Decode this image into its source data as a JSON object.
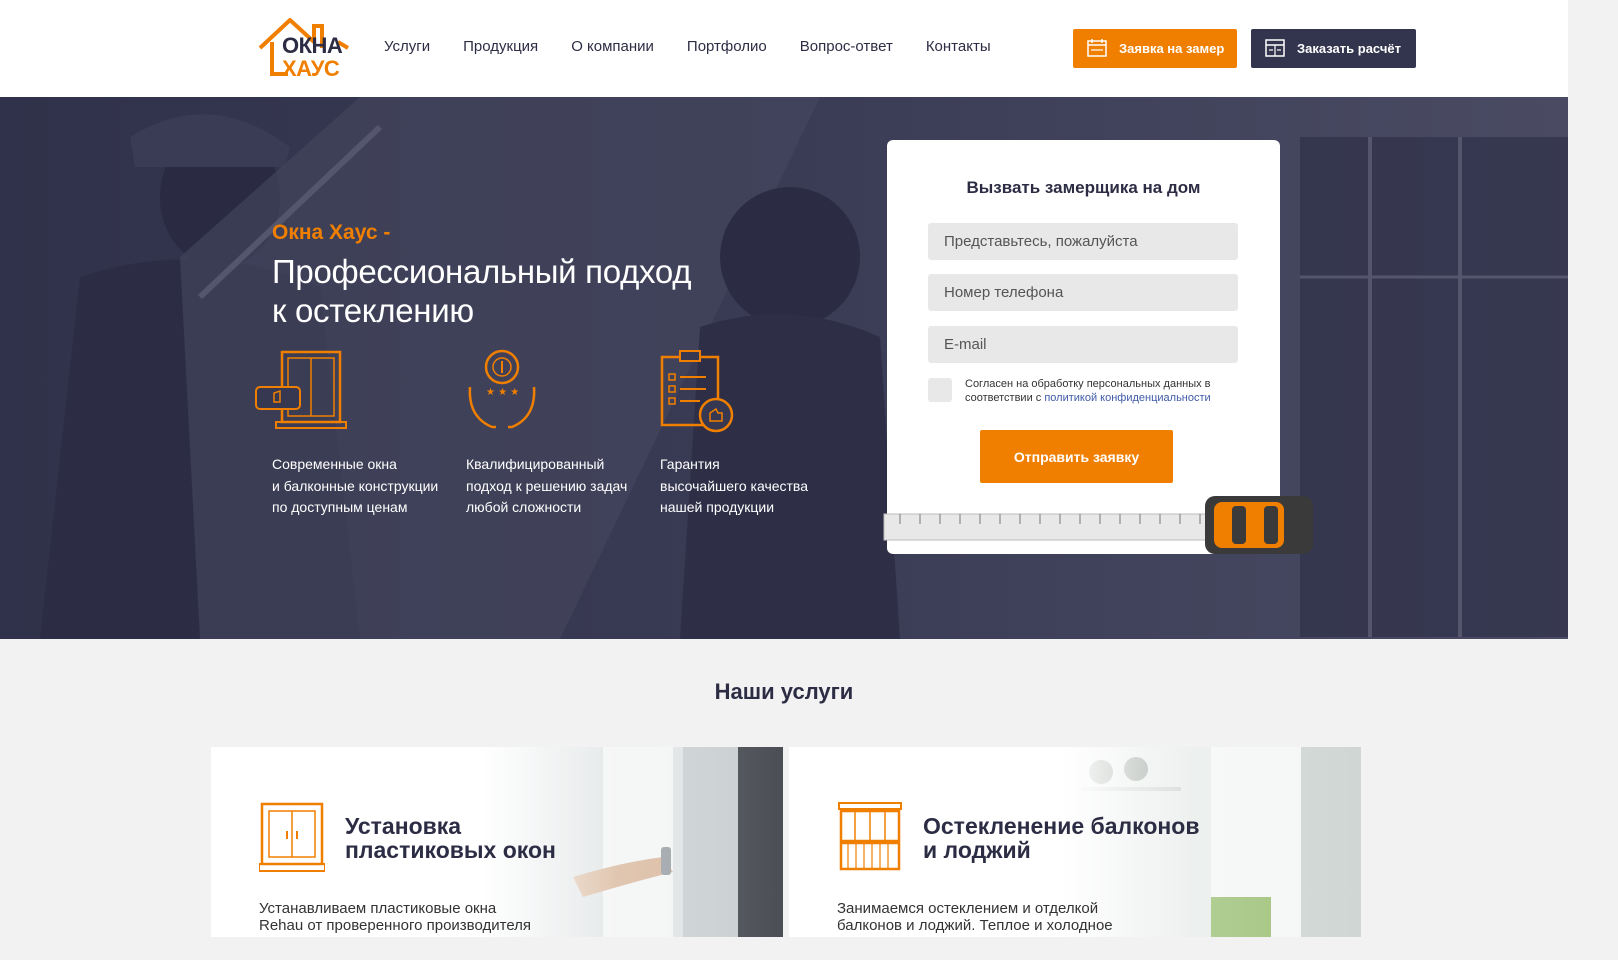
{
  "header": {
    "logo_line1": "ОКНА",
    "logo_line2": "ХАУС",
    "nav": [
      "Услуги",
      "Продукция",
      "О компании",
      "Портфолио",
      "Вопрос-ответ",
      "Контакты"
    ],
    "btn_zamer": "Заявка на замер",
    "btn_raschet": "Заказать расчёт"
  },
  "hero": {
    "kicker": "Окна Хаус -",
    "title_line1": "Профессиональный подход",
    "title_line2": "к остеклению",
    "features": [
      {
        "icon": "window-like-icon",
        "lines": [
          "Современные окна",
          "и балконные конструкции",
          "по доступным ценам"
        ]
      },
      {
        "icon": "medal-hands-icon",
        "lines": [
          "Квалифицированный",
          "подход к решению задач",
          "любой сложности"
        ]
      },
      {
        "icon": "checklist-like-icon",
        "lines": [
          "Гарантия",
          "высочайшего качества",
          "нашей продукции"
        ]
      }
    ]
  },
  "form": {
    "title": "Вызвать замерщика на дом",
    "name_placeholder": "Представьтесь, пожалуйста",
    "phone_placeholder": "Номер телефона",
    "email_placeholder": "E-mail",
    "consent_text": "Согласен на обработку персональных данных в соответствии с ",
    "consent_link": "политикой конфиденциальности",
    "submit": "Отправить заявку"
  },
  "services": {
    "title": "Наши услуги",
    "cards": [
      {
        "icon": "window-icon",
        "title_line1": "Установка",
        "title_line2": "пластиковых окон",
        "desc_line1": "Устанавливаем пластиковые окна",
        "desc_line2": "Rehau от проверенного производителя"
      },
      {
        "icon": "balcony-icon",
        "title_line1": "Остекленение балконов",
        "title_line2": "и лоджий",
        "desc_line1": "Занимаемся остеклением и отделкой",
        "desc_line2": "балконов и лоджий. Теплое и холодное"
      }
    ]
  },
  "colors": {
    "accent": "#f07f00",
    "dark": "#33354f",
    "hero_bg": "#363750"
  }
}
